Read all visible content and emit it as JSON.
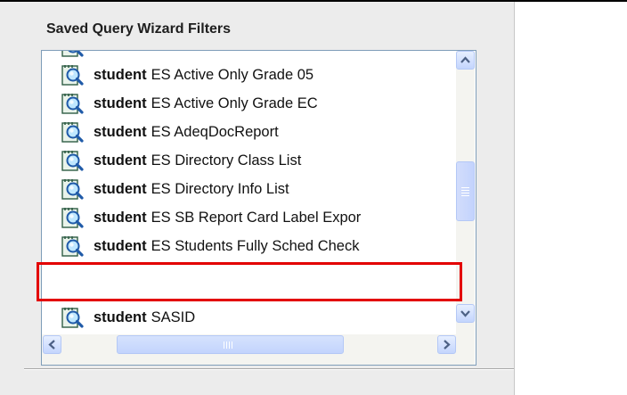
{
  "section": {
    "title": "Saved Query Wizard Filters"
  },
  "list": {
    "items": [
      {
        "type": "student",
        "name": "ES Active Only Grade 05",
        "icon": "query-magnifier-icon"
      },
      {
        "type": "student",
        "name": "ES Active Only Grade EC",
        "icon": "query-magnifier-icon"
      },
      {
        "type": "student",
        "name": "ES AdeqDocReport",
        "icon": "query-magnifier-icon"
      },
      {
        "type": "student",
        "name": "ES Directory Class List",
        "icon": "query-magnifier-icon"
      },
      {
        "type": "student",
        "name": "ES Directory Info List",
        "icon": "query-magnifier-icon"
      },
      {
        "type": "student",
        "name": "ES SB Report Card Label Expor",
        "icon": "query-magnifier-icon"
      },
      {
        "type": "student",
        "name": "ES Students Fully Sched Check",
        "icon": "query-magnifier-icon",
        "highlighted": true
      },
      {
        "type": "student",
        "name": "SASID",
        "icon": "query-magnifier-icon"
      }
    ]
  },
  "annotation": {
    "highlight_color": "#e30000"
  },
  "colors": {
    "panel_bg": "#ececec",
    "list_border": "#7f9db9",
    "scrollbar_accent": "#c3d5fd",
    "arrow": "#4d6185"
  }
}
